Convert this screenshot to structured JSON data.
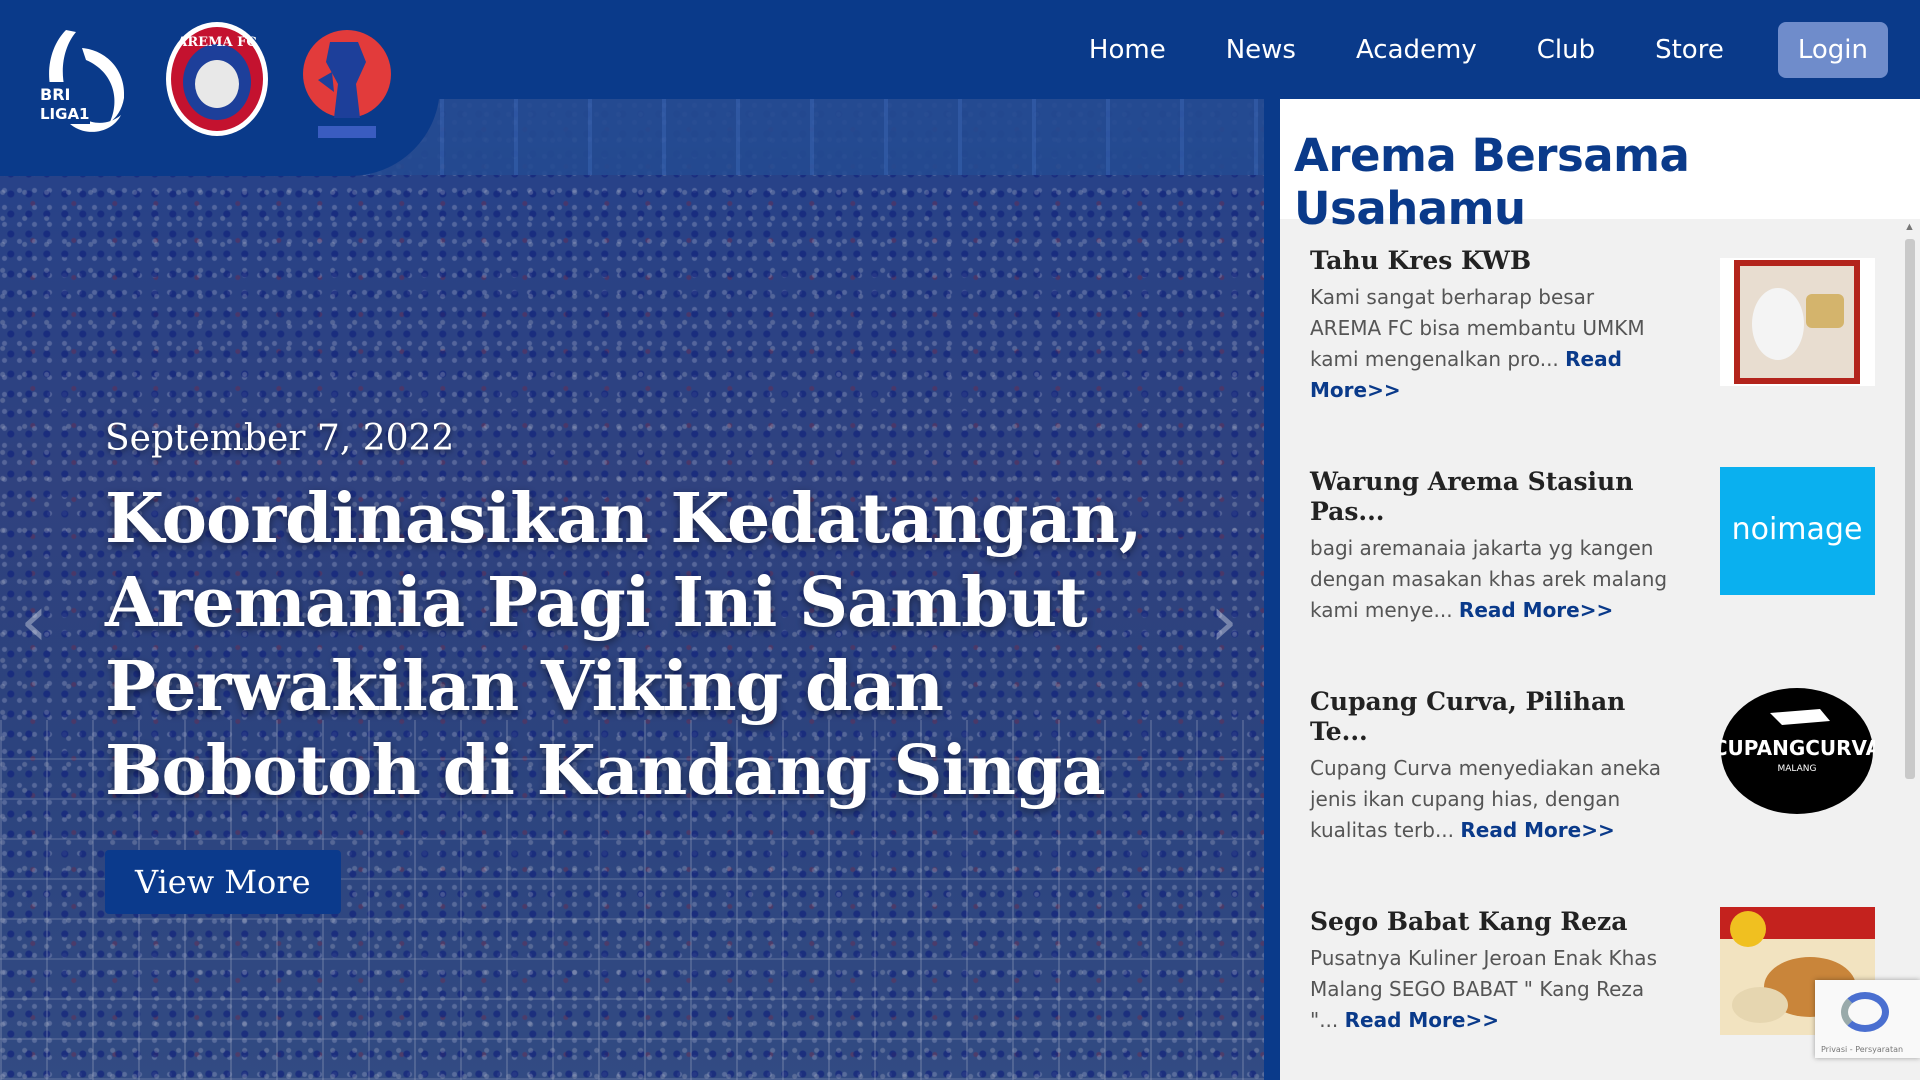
{
  "nav": {
    "items": [
      "Home",
      "News",
      "Academy",
      "Club",
      "Store"
    ],
    "login": "Login"
  },
  "logos": {
    "liga": "BRI LIGA 1",
    "arema": "AREMA FC"
  },
  "hero": {
    "date": "September 7, 2022",
    "title": "Koordinasikan Kedatangan, Aremania Pagi Ini Sambut Perwakilan Viking dan Bobotoh di Kandang Singa",
    "button": "View More"
  },
  "sidebar": {
    "title": "Arema Bersama Usahamu",
    "items": [
      {
        "title": "Tahu Kres KWB",
        "text": "Kami sangat berharap besar AREMA FC bisa membantu UMKM kami mengenalkan pro...",
        "read": "Read More>>"
      },
      {
        "title": "Warung Arema Stasiun Pas...",
        "text": "bagi aremanaia jakarta yg kangen dengan masakan khas arek malang kami menye...",
        "read": "Read More>>"
      },
      {
        "title": "Cupang Curva, Pilihan Te...",
        "text": "Cupang Curva menyediakan aneka jenis ikan cupang hias, dengan kualitas terb...",
        "read": "Read More>>"
      },
      {
        "title": "Sego Babat Kang Reza",
        "text": "Pusatnya Kuliner Jeroan Enak Khas Malang SEGO BABAT \" Kang Reza \"...",
        "read": "Read More>>"
      }
    ],
    "noimage": "noimage",
    "cupang_logo": "CUPANGCURVA",
    "cupang_sub": "MALANG"
  },
  "recaptcha": "Privasi - Persyaratan",
  "colors": {
    "brand": "#0a3a8a",
    "login": "#6f8ccb",
    "noimage": "#0ab0ef"
  }
}
